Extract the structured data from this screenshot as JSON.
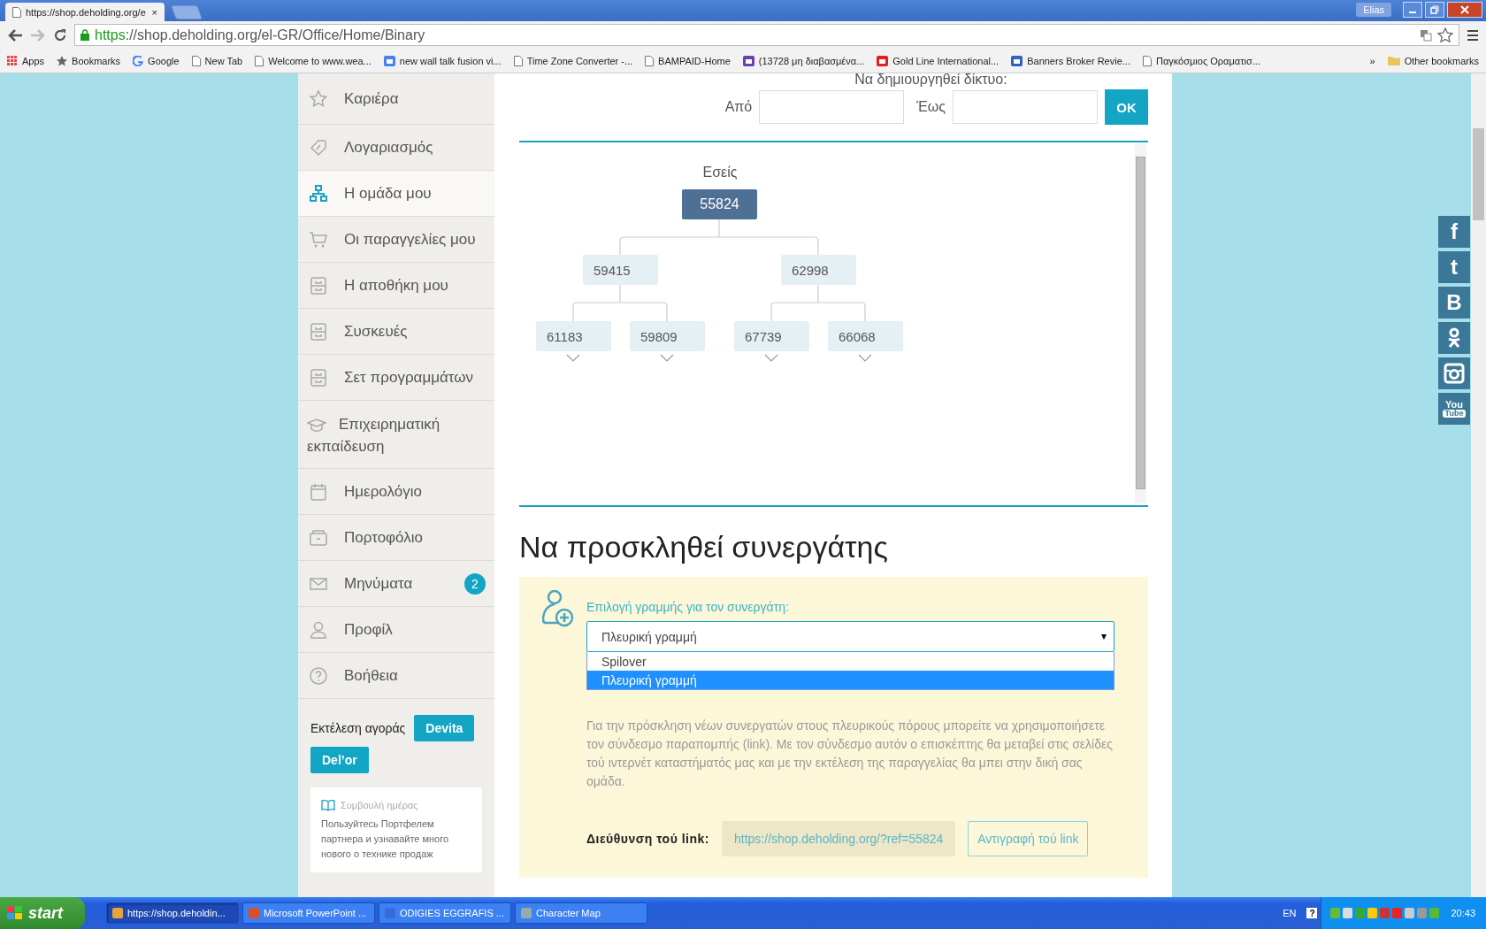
{
  "browser": {
    "tab": {
      "title": "https://shop.deholding.org/e",
      "close": "×"
    },
    "user": "Elias",
    "url_scheme": "https",
    "url_rest": "://shop.deholding.org/el-GR/Office/Home/Binary",
    "bookmarks": [
      {
        "label": "Apps"
      },
      {
        "label": "Bookmarks"
      },
      {
        "label": "Google"
      },
      {
        "label": "New Tab"
      },
      {
        "label": "Welcome to www.wea..."
      },
      {
        "label": "new wall talk fusion vi..."
      },
      {
        "label": "Time Zone Converter -..."
      },
      {
        "label": "BAMPAID-Home"
      },
      {
        "label": "(13728 μη διαβασμένα..."
      },
      {
        "label": "Gold Line International..."
      },
      {
        "label": "Banners Broker Revie..."
      },
      {
        "label": "Παγκόσμιος Οραματισ..."
      }
    ],
    "more": "»",
    "other_bookmarks": "Other bookmarks"
  },
  "sidebar": {
    "items": [
      {
        "label": "Καριέρα",
        "selected": false
      },
      {
        "label": "Λογαριασμός",
        "selected": false
      },
      {
        "label": "Η ομάδα μου",
        "selected": true
      },
      {
        "label": "Οι παραγγελίες μου",
        "selected": false
      },
      {
        "label": "Η αποθήκη μου",
        "selected": false
      },
      {
        "label": "Συσκευές",
        "selected": false
      },
      {
        "label": "Σετ προγραμμάτων",
        "selected": false
      },
      {
        "label": "Επιχειρηματική εκπαίδευση",
        "selected": false
      },
      {
        "label": "Ημερολόγιο",
        "selected": false
      },
      {
        "label": "Πορτοφόλιο",
        "selected": false
      },
      {
        "label": "Μηνύματα",
        "selected": false,
        "badge": "2"
      },
      {
        "label": "Προφίλ",
        "selected": false
      },
      {
        "label": "Βοήθεια",
        "selected": false
      }
    ],
    "purchase": {
      "label": "Εκτέλεση αγοράς",
      "buttons": [
        "Devita",
        "Del’or"
      ]
    },
    "tip": {
      "title": "Συμβουλή ημέρας",
      "text": "Пользуйтесь Портфелем партнера и узнавайте много нового о технике продаж"
    }
  },
  "network": {
    "heading": "Να δημιουργηθεί δίκτυο:",
    "from_label": "Από",
    "to_label": "Έως",
    "ok": "OK",
    "you_label": "Εσείς",
    "tree": {
      "id": "55824",
      "children": [
        {
          "id": "59415",
          "children": [
            {
              "id": "61183",
              "collapsed": true
            },
            {
              "id": "59809",
              "collapsed": true
            }
          ]
        },
        {
          "id": "62998",
          "children": [
            {
              "id": "67739",
              "collapsed": true
            },
            {
              "id": "66068",
              "collapsed": true
            }
          ]
        }
      ]
    }
  },
  "invite": {
    "heading": "Να προσκληθεί συνεργάτης",
    "select_label": "Επιλογή γραμμής για τον συνεργάτη:",
    "select_value": "Πλευρική γραμμή",
    "options": [
      {
        "label": "Spilover",
        "selected": false
      },
      {
        "label": "Πλευρική γραμμή",
        "selected": true
      }
    ],
    "description": "Για την πρόσκληση νέων συνεργατών στους πλευρικούς πόρους μπορείτε να χρησιμοποιήσετε τον σύνδεσμο παραπομπής (link). Με τον σύνδεσμο αυτόν ο επισκέπτης θα μεταβεί στις σελίδες τού ιντερνέτ καταστήματός μας και με την εκτέλεση της παραγγελίας θα μπει στην δική σας ομάδα.",
    "link_label": "Διεύθυνση τού link:",
    "link": "https://shop.deholding.org/?ref=55824",
    "copy": "Αντιγραφή τού link"
  },
  "social": [
    {
      "kind": "letter",
      "text": "f"
    },
    {
      "kind": "letter",
      "text": "t"
    },
    {
      "kind": "letter",
      "text": "B"
    },
    {
      "kind": "icon"
    },
    {
      "kind": "icon"
    },
    {
      "kind": "youtube",
      "text": "You",
      "text2": "Tube"
    }
  ],
  "taskbar": {
    "start": "start",
    "tasks": [
      {
        "label": "https://shop.deholdin...",
        "selected": true
      },
      {
        "label": "Microsoft PowerPoint ...",
        "selected": false
      },
      {
        "label": "ODIGIES EGGRAFIS ...",
        "selected": false
      },
      {
        "label": "Character Map",
        "selected": false
      }
    ],
    "lang": "EN",
    "help": "?",
    "clock": "20:43"
  }
}
